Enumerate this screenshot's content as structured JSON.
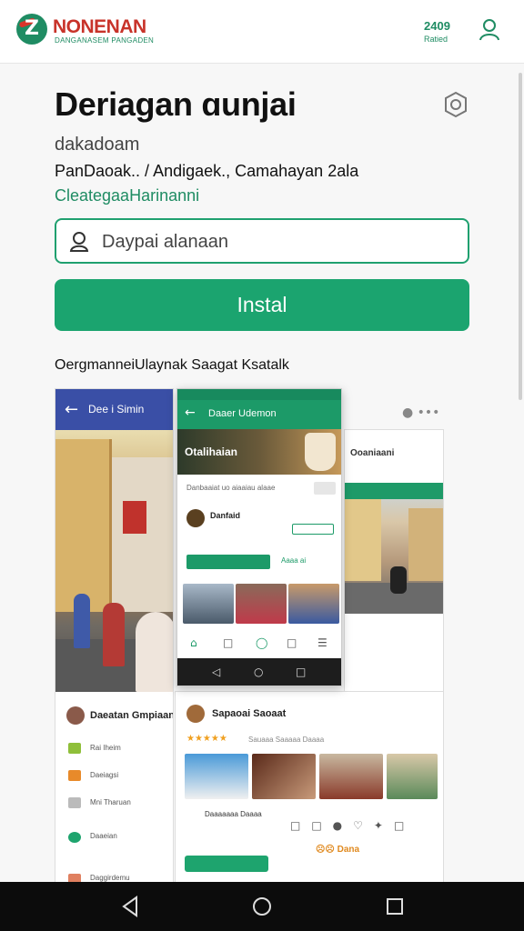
{
  "header": {
    "brand_name": "NONENAN",
    "brand_tagline": "DANGANASEM PANGADEN",
    "count": "2409",
    "count_label": "Ratied"
  },
  "app": {
    "title": "Deriagan ɑunjai",
    "subtitle": "dakadoam",
    "meta": "PanDaoak.. / Andigaek., Camahayan 2ala",
    "category": "CleategaaHarinanni"
  },
  "search": {
    "placeholder": "Daypai alanaan"
  },
  "install": {
    "label": "Instal"
  },
  "screenshots": {
    "section_label": "OergmanneiUlaynak Saagat Ksatalk",
    "shot1": {
      "bar_title": "Dee i Simin",
      "list_header": "Daeatan Gmpiaan",
      "items": [
        "Rai Iheim",
        "Daeiagsi",
        "Mni Tharuan",
        "Daaeian",
        "Daggirdemu"
      ]
    },
    "shot2": {
      "bar_title": "Daaer Udemon",
      "hero_title": "Otalihaian",
      "sub": "Danbaaiat uo aiaaiau alaae",
      "user": "Danfaid",
      "cta_secondary": "Aaaa ai"
    },
    "shot3": {
      "title": "Ooaniaani"
    },
    "shot4": {
      "user": "Sapaoai Saoaat",
      "stars": "★★★★★",
      "rating_text": "Sauaaa Saaaaa Daaaa",
      "caption": "Daaaaaaa Daaaa",
      "reactions": "☹☹ Dana"
    },
    "colors": {
      "accent": "#1ba46f",
      "blue_bar": "#3a4fa6",
      "brand_red": "#c8332a"
    }
  }
}
